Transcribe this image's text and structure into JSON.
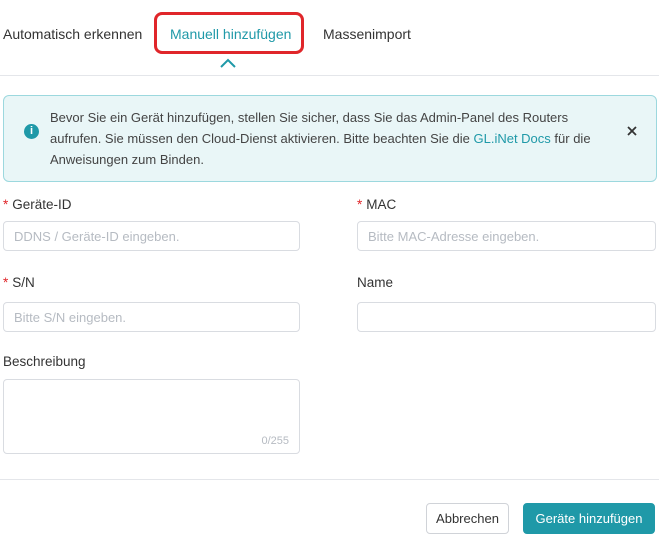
{
  "tabs": {
    "auto": "Automatisch erkennen",
    "manual": "Manuell hinzufügen",
    "bulk": "Massenimport",
    "active": "manual"
  },
  "alert": {
    "line_before_link": "Bevor Sie ein Gerät hinzufügen, stellen Sie sicher, dass Sie das Admin-Panel des Routers aufrufen. Sie müssen den Cloud-Dienst aktivieren. Bitte beachten Sie die",
    "link_text": "GL.iNet Docs",
    "line_after_link": "für die Anweisungen zum Binden.",
    "icon": "info-icon",
    "close_icon": "close-icon"
  },
  "form": {
    "required_mark": "*",
    "device_id": {
      "label": "Geräte-ID",
      "placeholder": "DDNS / Geräte-ID eingeben.",
      "value": ""
    },
    "mac": {
      "label": "MAC",
      "placeholder": "Bitte MAC-Adresse eingeben.",
      "value": ""
    },
    "sn": {
      "label": "S/N",
      "placeholder": "Bitte S/N eingeben.",
      "value": ""
    },
    "name": {
      "label": "Name",
      "placeholder": "",
      "value": ""
    },
    "description": {
      "label": "Beschreibung",
      "value": "",
      "counter": "0/255"
    }
  },
  "footer": {
    "cancel_label": "Abbrechen",
    "submit_label": "Geräte hinzufügen"
  },
  "colors": {
    "accent": "#1f99a8",
    "highlight": "#e0262a",
    "alert_bg": "#e9f6f7"
  }
}
